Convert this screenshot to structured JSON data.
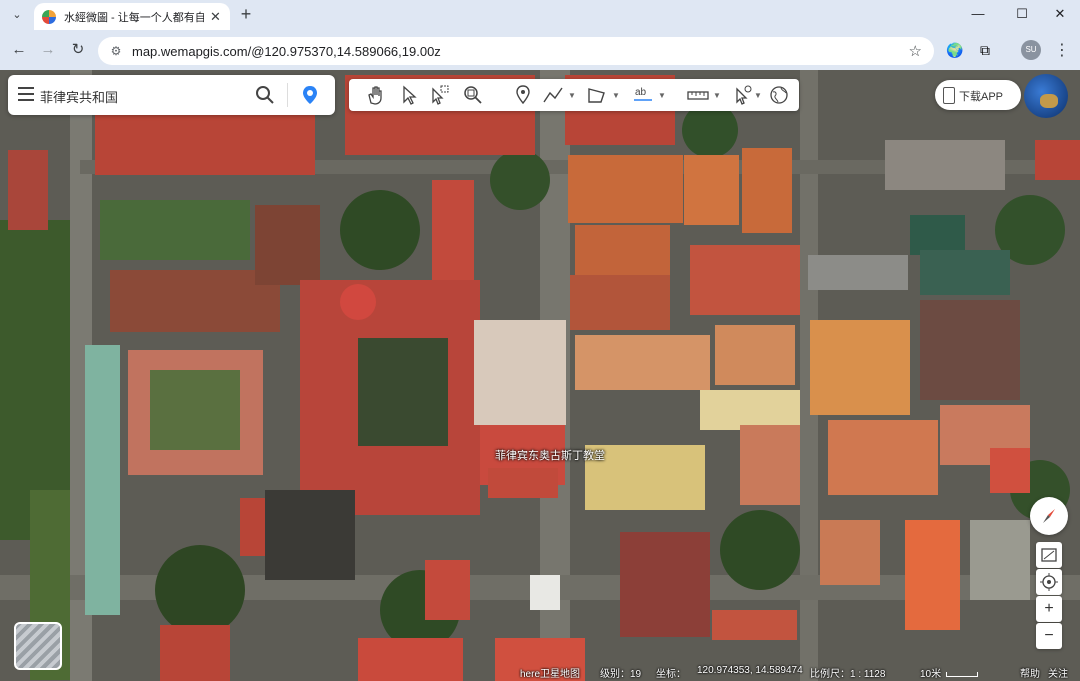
{
  "browser": {
    "tab_title": "水經微圖 - 让每一个人都有自已",
    "url": "map.wemapgis.com/@120.975370,14.589066,19.00z",
    "avatar_text": "SU"
  },
  "searchbox": {
    "text": "菲律宾共和国"
  },
  "map": {
    "place_label": "菲律宾东奥古斯丁教堂",
    "download_label": "下载APP"
  },
  "status": {
    "source": "here卫星地图",
    "level": "级别：19",
    "coords_label": "坐标：",
    "coords_value": "120.974353, 14.589474",
    "scale": "比例尺：1 : 1128",
    "scale_bar": "10米",
    "help": "帮助",
    "follow": "关注"
  },
  "colors": {
    "roof_red": "#b5413a",
    "roof_orange": "#c66a3c",
    "accent_blue": "#2b83f6"
  }
}
